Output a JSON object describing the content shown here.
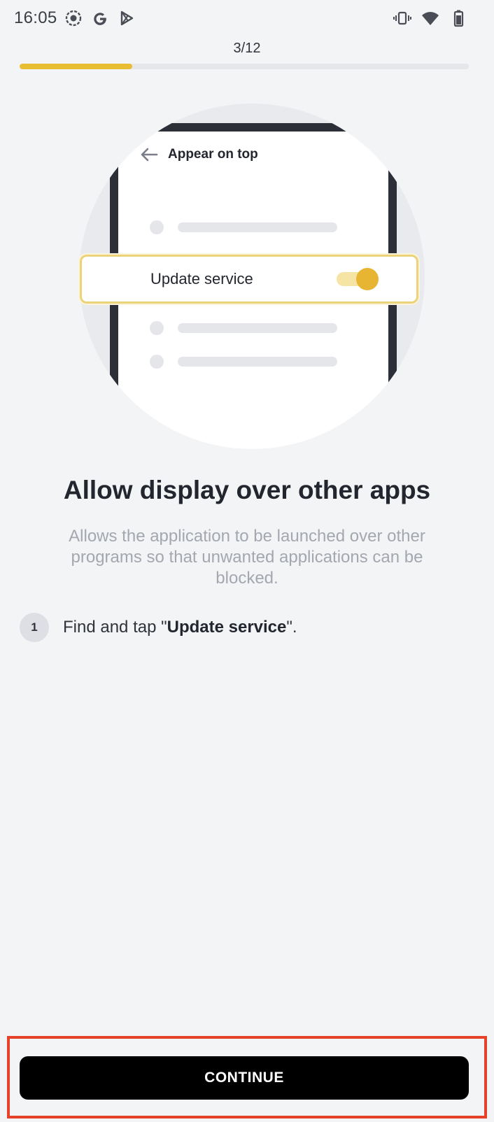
{
  "status_bar": {
    "time": "16:05",
    "left_icons": [
      "record-icon",
      "google-icon",
      "play-store-icon"
    ],
    "right_icons": [
      "vibrate-icon",
      "wifi-icon",
      "battery-icon"
    ]
  },
  "progress": {
    "label": "3/12",
    "current": 3,
    "total": 12,
    "fraction": 0.25,
    "color": "#e9bd32"
  },
  "illustration": {
    "screen_title": "Appear on top",
    "back_icon": "arrow-left-icon",
    "highlight_label": "Update service",
    "toggle_state": "on",
    "accent": "#e7b531"
  },
  "content": {
    "title": "Allow display over other apps",
    "subtitle": "Allows the application to be launched over other programs so that unwanted applications can be blocked.",
    "steps": [
      {
        "number": "1",
        "prefix": "Find and tap \"",
        "bold": "Update service",
        "suffix": "\"."
      }
    ]
  },
  "footer": {
    "continue_label": "CONTINUE",
    "button_color": "#000000",
    "frame_color": "#e6412b"
  }
}
